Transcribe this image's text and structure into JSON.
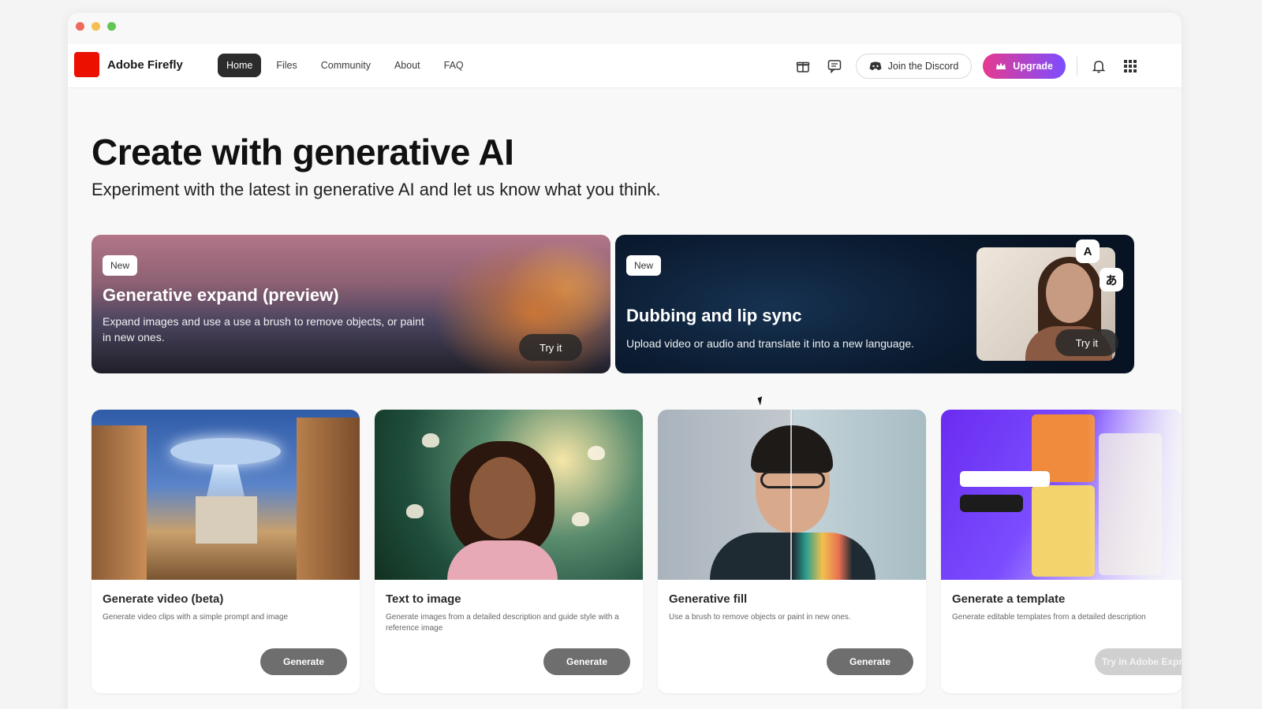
{
  "window": {
    "controls": [
      "close",
      "minimize",
      "maximize"
    ]
  },
  "header": {
    "brand": "Adobe Firefly",
    "tabs": [
      {
        "label": "Home",
        "active": true
      },
      {
        "label": "Files",
        "active": false
      },
      {
        "label": "Community",
        "active": false
      },
      {
        "label": "About",
        "active": false
      },
      {
        "label": "FAQ",
        "active": false
      }
    ],
    "icons": [
      "gift-icon",
      "feedback-icon",
      "bell-icon",
      "apps-grid-icon"
    ],
    "discord_label": "Join the Discord",
    "upgrade_label": "Upgrade"
  },
  "hero": {
    "title": "Create with generative AI",
    "subtitle": "Experiment with the latest in generative AI and let us know what you think."
  },
  "features": [
    {
      "badge": "New",
      "title": "Generative expand (preview)",
      "description": "Expand images and use a use a brush to remove objects, or paint in new ones.",
      "button": "Try it"
    },
    {
      "badge": "New",
      "title": "Dubbing and lip sync",
      "description": "Upload video or audio and translate it into a new language.",
      "button": "Try it",
      "lang_chips": [
        "A",
        "あ"
      ]
    }
  ],
  "cards": [
    {
      "title": "Generate video (beta)",
      "description": "Generate video clips with a simple prompt and image",
      "button": "Generate"
    },
    {
      "title": "Text to image",
      "description": "Generate images from a detailed description and guide style with a reference image",
      "button": "Generate"
    },
    {
      "title": "Generative fill",
      "description": "Use a brush to remove objects or paint in new ones.",
      "button": "Generate"
    },
    {
      "title": "Generate a template",
      "description": "Generate editable templates from a detailed description",
      "button": "Try in Adobe Express"
    }
  ],
  "colors": {
    "brand_red": "#eb1000",
    "active_tab": "#2c2c2c",
    "upgrade_gradient_start": "#e63a8f",
    "upgrade_gradient_end": "#7c4dff"
  }
}
